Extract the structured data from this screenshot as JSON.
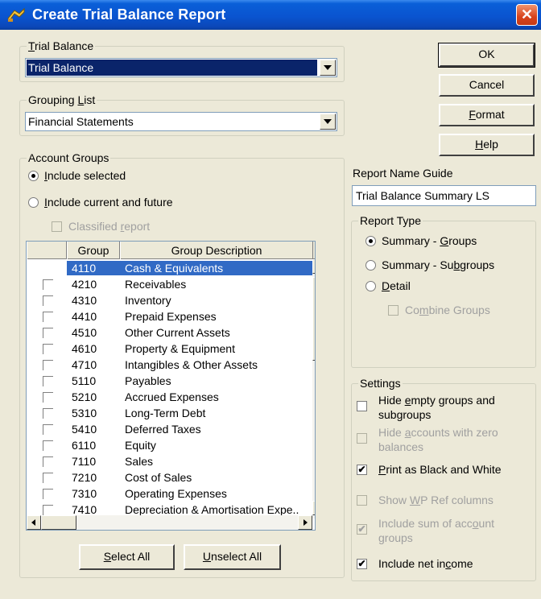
{
  "window": {
    "title": "Create Trial Balance Report",
    "close_glyph": "✕"
  },
  "trial_balance": {
    "legend": "Trial Balance",
    "legend_accel": "T",
    "legend_rest": "rial Balance",
    "value": "Trial Balance"
  },
  "grouping_list": {
    "legend_pre": "Grouping ",
    "legend_accel": "L",
    "legend_rest": "ist",
    "value": "Financial Statements"
  },
  "account_groups": {
    "legend": "Account Groups",
    "include_selected": {
      "accel": "I",
      "rest": "nclude selected",
      "selected": true
    },
    "include_current": {
      "accel": "I",
      "rest": "nclude current and future",
      "selected": false
    },
    "classified": {
      "pre": "Classified ",
      "accel": "r",
      "rest": "eport",
      "checked": false
    },
    "columns": {
      "group": "Group",
      "description": "Group Description"
    },
    "rows": [
      {
        "code": "4110",
        "desc": "Cash & Equivalents",
        "selected": true
      },
      {
        "code": "4210",
        "desc": "Receivables"
      },
      {
        "code": "4310",
        "desc": "Inventory"
      },
      {
        "code": "4410",
        "desc": "Prepaid Expenses"
      },
      {
        "code": "4510",
        "desc": "Other Current Assets"
      },
      {
        "code": "4610",
        "desc": "Property & Equipment"
      },
      {
        "code": "4710",
        "desc": "Intangibles & Other Assets"
      },
      {
        "code": "5110",
        "desc": "Payables"
      },
      {
        "code": "5210",
        "desc": "Accrued Expenses"
      },
      {
        "code": "5310",
        "desc": "Long-Term Debt"
      },
      {
        "code": "5410",
        "desc": "Deferred Taxes"
      },
      {
        "code": "6110",
        "desc": "Equity"
      },
      {
        "code": "7110",
        "desc": "Sales"
      },
      {
        "code": "7210",
        "desc": "Cost of Sales"
      },
      {
        "code": "7310",
        "desc": "Operating Expenses"
      },
      {
        "code": "7410",
        "desc": "Depreciation & Amortisation Expe.."
      }
    ],
    "select_all": {
      "accel": "S",
      "rest": "elect All"
    },
    "unselect_all": {
      "accel": "U",
      "rest": "nselect All"
    }
  },
  "buttons": {
    "ok": "OK",
    "cancel": "Cancel",
    "format": {
      "accel": "F",
      "rest": "ormat"
    },
    "help": {
      "accel": "H",
      "rest": "elp"
    }
  },
  "report_name_guide": {
    "label": "Report Name Guide",
    "value": "Trial Balance Summary LS"
  },
  "report_type": {
    "legend": "Report Type",
    "summary_groups": {
      "pre": "Summary - ",
      "accel": "G",
      "rest": "roups",
      "selected": true
    },
    "summary_subgroups": {
      "pre": "Summary - Su",
      "accel": "b",
      "rest": "groups",
      "selected": false
    },
    "detail": {
      "accel": "D",
      "rest": "etail",
      "selected": false
    },
    "combine_groups": {
      "pre": "Co",
      "accel": "m",
      "rest": "bine Groups",
      "checked": false
    }
  },
  "settings": {
    "legend": "Settings",
    "hide_empty": {
      "pre": "Hide ",
      "accel": "e",
      "rest": "mpty groups and",
      "line2": "subgroups",
      "checked": false
    },
    "hide_zero": {
      "pre": "Hide ",
      "accel": "a",
      "rest": "ccounts with zero",
      "line2": "balances",
      "checked": false
    },
    "black_white": {
      "accel": "P",
      "rest": "rint as Black and White",
      "checked": true
    },
    "show_wp": {
      "pre": "Show ",
      "accel": "W",
      "rest": "P Ref columns",
      "checked": false
    },
    "include_sum": {
      "pre": "Include sum of acc",
      "accel": "o",
      "rest": "unt",
      "line2": "groups",
      "checked": true
    },
    "include_net": {
      "pre": "Include net in",
      "accel": "c",
      "rest": "ome",
      "checked": true
    }
  },
  "check_glyph": "✔"
}
